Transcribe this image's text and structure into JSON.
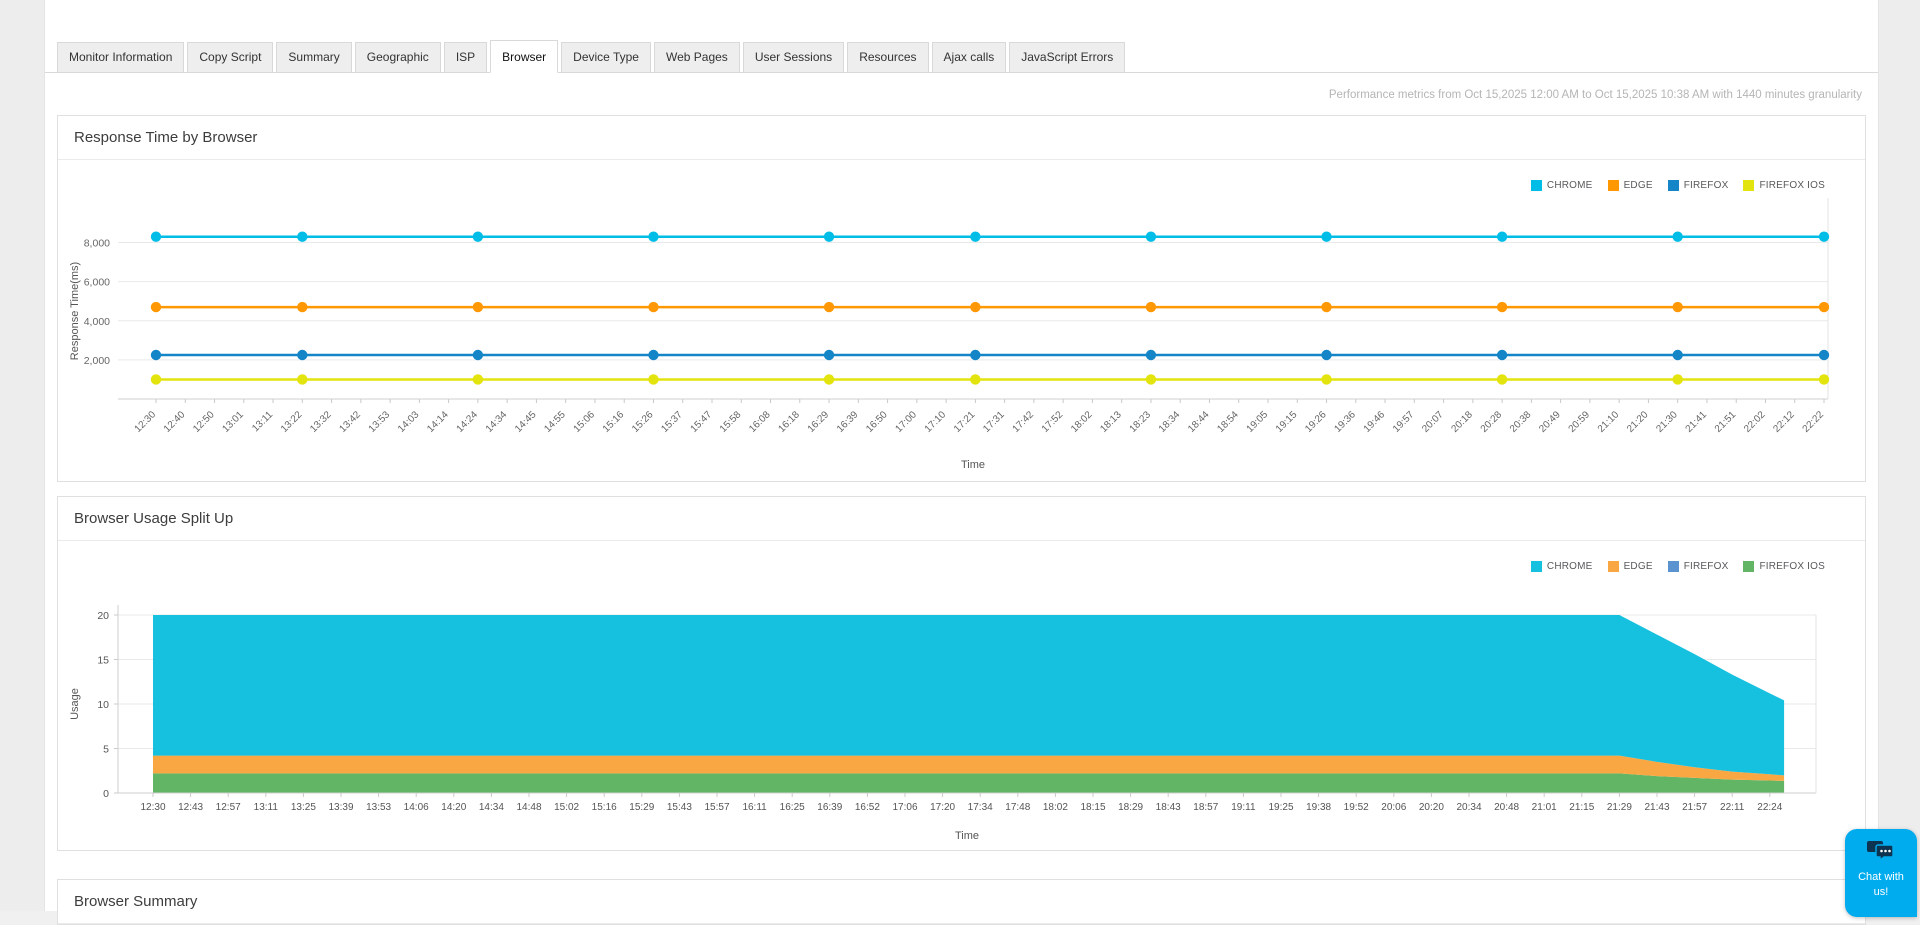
{
  "page": {
    "background": "#f0f0f0",
    "content_background": "#ffffff"
  },
  "tabs": {
    "active": "Browser",
    "items": [
      "Monitor Information",
      "Copy Script",
      "Summary",
      "Geographic",
      "ISP",
      "Browser",
      "Device Type",
      "Web Pages",
      "User Sessions",
      "Resources",
      "Ajax calls",
      "JavaScript Errors"
    ]
  },
  "meta_note": "Performance metrics from Oct 15,2025 12:00 AM to Oct 15,2025 10:38 AM with 1440 minutes granularity",
  "panels": {
    "response_time": {
      "title": "Response Time by Browser"
    },
    "usage": {
      "title": "Browser Usage Split Up"
    },
    "summary": {
      "title": "Browser Summary"
    }
  },
  "chat": {
    "label": "Chat with us!",
    "color": "#00ACEE"
  },
  "chart_data": [
    {
      "type": "line",
      "title": "Response Time by Browser",
      "xlabel": "Time",
      "ylabel": "Response Time(ms)",
      "ylim": [
        0,
        9000
      ],
      "yticks": [
        2000,
        4000,
        6000,
        8000
      ],
      "ytick_labels": [
        "2,000",
        "4,000",
        "6,000",
        "8,000"
      ],
      "grid": "horizontal",
      "legend_position": "top-right",
      "legend": [
        "CHROME",
        "EDGE",
        "FIREFOX",
        "FIREFOX IOS"
      ],
      "marker_indices": [
        0,
        5,
        11,
        17,
        23,
        28,
        34,
        40,
        46,
        52,
        57
      ],
      "categories": [
        "12:30",
        "12:40",
        "12:50",
        "13:01",
        "13:11",
        "13:22",
        "13:32",
        "13:42",
        "13:53",
        "14:03",
        "14:14",
        "14:24",
        "14:34",
        "14:45",
        "14:55",
        "15:06",
        "15:16",
        "15:26",
        "15:37",
        "15:47",
        "15:58",
        "16:08",
        "16:18",
        "16:29",
        "16:39",
        "16:50",
        "17:00",
        "17:10",
        "17:21",
        "17:31",
        "17:42",
        "17:52",
        "18:02",
        "18:13",
        "18:23",
        "18:34",
        "18:44",
        "18:54",
        "19:05",
        "19:15",
        "19:26",
        "19:36",
        "19:46",
        "19:57",
        "20:07",
        "20:18",
        "20:28",
        "20:38",
        "20:49",
        "20:59",
        "21:10",
        "21:20",
        "21:30",
        "21:41",
        "21:51",
        "22:02",
        "22:12",
        "22:22"
      ],
      "series": [
        {
          "name": "CHROME",
          "color": "#00BDE7",
          "values": [
            8300,
            8300,
            8300,
            8300,
            8300,
            8300,
            8300,
            8300,
            8300,
            8300,
            8300,
            8300,
            8300,
            8300,
            8300,
            8300,
            8300,
            8300,
            8300,
            8300,
            8300,
            8300,
            8300,
            8300,
            8300,
            8300,
            8300,
            8300,
            8300,
            8300,
            8300,
            8300,
            8300,
            8300,
            8300,
            8300,
            8300,
            8300,
            8300,
            8300,
            8300,
            8300,
            8300,
            8300,
            8300,
            8300,
            8300,
            8300,
            8300,
            8300,
            8300,
            8300,
            8300,
            8300,
            8300,
            8300,
            8300,
            8300
          ]
        },
        {
          "name": "EDGE",
          "color": "#FF9803",
          "values": [
            4700,
            4700,
            4700,
            4700,
            4700,
            4700,
            4700,
            4700,
            4700,
            4700,
            4700,
            4700,
            4700,
            4700,
            4700,
            4700,
            4700,
            4700,
            4700,
            4700,
            4700,
            4700,
            4700,
            4700,
            4700,
            4700,
            4700,
            4700,
            4700,
            4700,
            4700,
            4700,
            4700,
            4700,
            4700,
            4700,
            4700,
            4700,
            4700,
            4700,
            4700,
            4700,
            4700,
            4700,
            4700,
            4700,
            4700,
            4700,
            4700,
            4700,
            4700,
            4700,
            4700,
            4700,
            4700,
            4700,
            4700,
            4700
          ]
        },
        {
          "name": "FIREFOX",
          "color": "#1486C8",
          "values": [
            2250,
            2250,
            2250,
            2250,
            2250,
            2250,
            2250,
            2250,
            2250,
            2250,
            2250,
            2250,
            2250,
            2250,
            2250,
            2250,
            2250,
            2250,
            2250,
            2250,
            2250,
            2250,
            2250,
            2250,
            2250,
            2250,
            2250,
            2250,
            2250,
            2250,
            2250,
            2250,
            2250,
            2250,
            2250,
            2250,
            2250,
            2250,
            2250,
            2250,
            2250,
            2250,
            2250,
            2250,
            2250,
            2250,
            2250,
            2250,
            2250,
            2250,
            2250,
            2250,
            2250,
            2250,
            2250,
            2250,
            2250,
            2250
          ]
        },
        {
          "name": "FIREFOX IOS",
          "color": "#E3E30E",
          "values": [
            1000,
            1000,
            1000,
            1000,
            1000,
            1000,
            1000,
            1000,
            1000,
            1000,
            1000,
            1000,
            1000,
            1000,
            1000,
            1000,
            1000,
            1000,
            1000,
            1000,
            1000,
            1000,
            1000,
            1000,
            1000,
            1000,
            1000,
            1000,
            1000,
            1000,
            1000,
            1000,
            1000,
            1000,
            1000,
            1000,
            1000,
            1000,
            1000,
            1000,
            1000,
            1000,
            1000,
            1000,
            1000,
            1000,
            1000,
            1000,
            1000,
            1000,
            1000,
            1000,
            1000,
            1000,
            1000,
            1000,
            1000,
            1000
          ]
        }
      ]
    },
    {
      "type": "area",
      "stacked": true,
      "title": "Browser Usage Split Up",
      "xlabel": "Time",
      "ylabel": "Usage",
      "ylim": [
        0,
        20
      ],
      "yticks": [
        0,
        5,
        10,
        15,
        20
      ],
      "grid": "horizontal",
      "legend_position": "top-right",
      "legend": [
        "CHROME",
        "EDGE",
        "FIREFOX",
        "FIREFOX IOS"
      ],
      "categories": [
        "12:30",
        "12:43",
        "12:57",
        "13:11",
        "13:25",
        "13:39",
        "13:53",
        "14:06",
        "14:20",
        "14:34",
        "14:48",
        "15:02",
        "15:16",
        "15:29",
        "15:43",
        "15:57",
        "16:11",
        "16:25",
        "16:39",
        "16:52",
        "17:06",
        "17:20",
        "17:34",
        "17:48",
        "18:02",
        "18:15",
        "18:29",
        "18:43",
        "18:57",
        "19:11",
        "19:25",
        "19:38",
        "19:52",
        "20:06",
        "20:20",
        "20:34",
        "20:48",
        "21:01",
        "21:15",
        "21:29",
        "21:43",
        "21:57",
        "22:11",
        "22:24"
      ],
      "stack_order_bottom_to_top": [
        "FIREFOX IOS",
        "EDGE",
        "FIREFOX",
        "CHROME"
      ],
      "series": [
        {
          "name": "FIREFOX IOS",
          "color": "#62B564",
          "values": [
            2.2,
            2.2,
            2.2,
            2.2,
            2.2,
            2.2,
            2.2,
            2.2,
            2.2,
            2.2,
            2.2,
            2.2,
            2.2,
            2.2,
            2.2,
            2.2,
            2.2,
            2.2,
            2.2,
            2.2,
            2.2,
            2.2,
            2.2,
            2.2,
            2.2,
            2.2,
            2.2,
            2.2,
            2.2,
            2.2,
            2.2,
            2.2,
            2.2,
            2.2,
            2.2,
            2.2,
            2.2,
            2.2,
            2.2,
            2.2,
            1.9,
            1.7,
            1.5,
            1.4
          ]
        },
        {
          "name": "EDGE",
          "color": "#F9A743",
          "values": [
            2.0,
            2.0,
            2.0,
            2.0,
            2.0,
            2.0,
            2.0,
            2.0,
            2.0,
            2.0,
            2.0,
            2.0,
            2.0,
            2.0,
            2.0,
            2.0,
            2.0,
            2.0,
            2.0,
            2.0,
            2.0,
            2.0,
            2.0,
            2.0,
            2.0,
            2.0,
            2.0,
            2.0,
            2.0,
            2.0,
            2.0,
            2.0,
            2.0,
            2.0,
            2.0,
            2.0,
            2.0,
            2.0,
            2.0,
            2.0,
            1.6,
            1.2,
            0.9,
            0.7
          ]
        },
        {
          "name": "FIREFOX",
          "color": "#5B93D1",
          "values": [
            0,
            0,
            0,
            0,
            0,
            0,
            0,
            0,
            0,
            0,
            0,
            0,
            0,
            0,
            0,
            0,
            0,
            0,
            0,
            0,
            0,
            0,
            0,
            0,
            0,
            0,
            0,
            0,
            0,
            0,
            0,
            0,
            0,
            0,
            0,
            0,
            0,
            0,
            0,
            0,
            0,
            0,
            0,
            0
          ]
        },
        {
          "name": "CHROME",
          "color": "#16C0DF",
          "values": [
            15.8,
            15.8,
            15.8,
            15.8,
            15.8,
            15.8,
            15.8,
            15.8,
            15.8,
            15.8,
            15.8,
            15.8,
            15.8,
            15.8,
            15.8,
            15.8,
            15.8,
            15.8,
            15.8,
            15.8,
            15.8,
            15.8,
            15.8,
            15.8,
            15.8,
            15.8,
            15.8,
            15.8,
            15.8,
            15.8,
            15.8,
            15.8,
            15.8,
            15.8,
            15.8,
            15.8,
            15.8,
            15.8,
            15.8,
            15.8,
            14.3,
            12.7,
            10.9,
            9.1
          ]
        }
      ]
    }
  ]
}
